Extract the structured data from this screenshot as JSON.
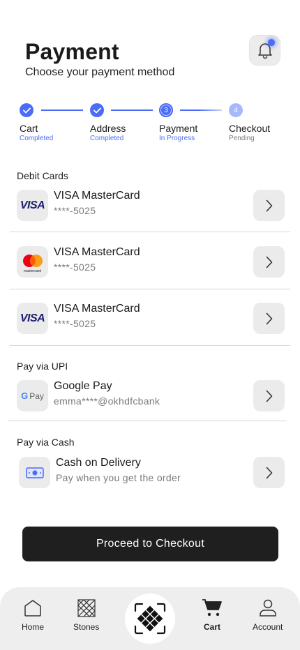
{
  "header": {
    "title": "Payment",
    "subtitle": "Choose your payment method"
  },
  "stepper": {
    "steps": [
      {
        "label": "Cart",
        "status": "Completed",
        "state": "done"
      },
      {
        "label": "Address",
        "status": "Completed",
        "state": "done"
      },
      {
        "label": "Payment",
        "status": "In Progress",
        "state": "current",
        "number": "3"
      },
      {
        "label": "Checkout",
        "status": "Pending",
        "state": "pending",
        "number": "4"
      }
    ]
  },
  "sections": {
    "debit": "Debit Cards",
    "upi": "Pay via UPI",
    "cash": "Pay via Cash"
  },
  "debit_cards": [
    {
      "title": "VISA MasterCard",
      "number": "****-5025",
      "brand": "visa",
      "brand_text": "VISA"
    },
    {
      "title": "VISA MasterCard",
      "number": "****-5025",
      "brand": "mastercard",
      "brand_text": "mastercard"
    },
    {
      "title": "VISA MasterCard",
      "number": "****-5025",
      "brand": "visa",
      "brand_text": "VISA"
    }
  ],
  "upi": {
    "title": "Google Pay",
    "id": "emma****@okhdfcbank",
    "brand_text": "G Pay"
  },
  "cash": {
    "title": "Cash on Delivery",
    "subtitle": "Pay when you get the order"
  },
  "checkout_button": "Proceed to Checkout",
  "nav": {
    "items": [
      {
        "label": "Home",
        "icon": "home-icon"
      },
      {
        "label": "Stones",
        "icon": "stones-icon"
      },
      {
        "label": "Cart",
        "icon": "cart-icon",
        "active": true
      },
      {
        "label": "Account",
        "icon": "account-icon"
      }
    ],
    "center_icon": "scan-icon"
  },
  "colors": {
    "accent": "#4a6cf7",
    "accent_light": "#a9b8fb",
    "button_dark": "#1f1f1f",
    "visa_blue": "#1a1f71",
    "mc_red": "#eb001b",
    "mc_orange": "#f79e1b"
  }
}
